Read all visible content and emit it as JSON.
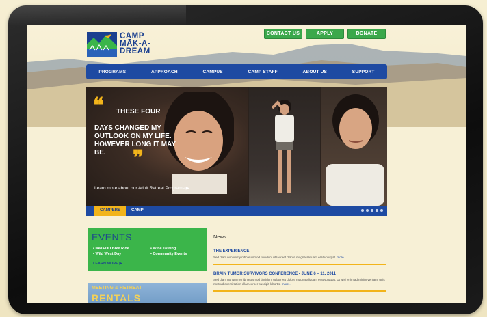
{
  "logo": {
    "line1": "CAMP",
    "line2": "MĀK-A-",
    "line3": "DREAM"
  },
  "top_buttons": [
    {
      "label": "CONTACT US"
    },
    {
      "label": "APPLY"
    },
    {
      "label": "DONATE"
    }
  ],
  "nav": {
    "items": [
      {
        "label": "PROGRAMS"
      },
      {
        "label": "APPROACH"
      },
      {
        "label": "CAMPUS"
      },
      {
        "label": "CAMP STAFF"
      },
      {
        "label": "ABOUT US"
      },
      {
        "label": "SUPPORT"
      }
    ]
  },
  "hero": {
    "quote_line1": "THESE FOUR",
    "quote_rest": "DAYS CHANGED MY OUTLOOK ON MY LIFE. HOWEVER LONG IT MAY BE.",
    "link": "Learn more about our Adult Retreat Programs ▶"
  },
  "tabs": [
    {
      "label": "CAMPERS"
    },
    {
      "label": "CAMP"
    }
  ],
  "events": {
    "title": "EVENTS",
    "items": [
      "• NATPOD Bike Ride",
      "• Wild West Day",
      "• Wine Tasting",
      "• Community Events"
    ],
    "learn_more": "LEARN MORE ▶"
  },
  "rentals": {
    "line1": "MEETING & RETREAT",
    "line2": "RENTALS"
  },
  "news": {
    "heading": "News",
    "items": [
      {
        "title": "THE EXPERIENCE",
        "body": "Sed diam nonummy nibh euismod tincidunt ut laoreet dolore magna aliquam erat volutpat.",
        "more": "more..."
      },
      {
        "title": "BRAIN TUMOR SURVIVORS CONFERENCE • JUNE 6 – 11, 2011",
        "body": "Sed diam nonummy nibh euismod tincidunt ut laoreet dolore magna aliquam erat volutpat. Ut wisi enim ad minim veniam, quis nostrud exerci tation ullamcorper suscipit lobortis.",
        "more": "more..."
      }
    ]
  },
  "colors": {
    "brand_blue": "#1e4aa2",
    "accent_yellow": "#f2b41b",
    "green": "#3bb54a",
    "device": "#111111"
  }
}
